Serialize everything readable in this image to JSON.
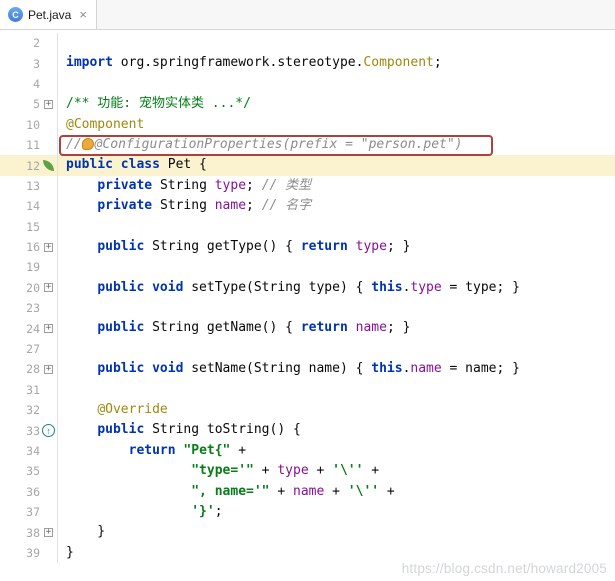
{
  "tab": {
    "title": "Pet.java",
    "close_glyph": "×",
    "icon_letter": "C"
  },
  "watermark": "https://blog.csdn.net/howard2005",
  "editor": {
    "colors": {
      "keyword": "#0033B3",
      "plain": "#080808",
      "annotation": "#9E880D",
      "comment": "#8C8C8C",
      "doc": "#067D17",
      "string": "#067D17",
      "field": "#871094",
      "line-number": "#A6A6A6",
      "current-line-bg": "#FBF2D0",
      "error-box": "#B1403B",
      "bean-icon": "#5FA243",
      "override-icon": "#0F8A80"
    },
    "lines": [
      {
        "num": 2,
        "segments": []
      },
      {
        "num": 3,
        "segments": [
          {
            "c": "keyword",
            "t": "import"
          },
          {
            "c": "plain",
            "t": " org.springframework.stereotype."
          },
          {
            "c": "annotation",
            "t": "Component"
          },
          {
            "c": "plain",
            "t": ";"
          }
        ]
      },
      {
        "num": 4,
        "segments": []
      },
      {
        "num": 5,
        "fold": "+",
        "segments": [
          {
            "c": "doc",
            "t": "/** 功能: 宠物实体类 ...*/"
          }
        ]
      },
      {
        "num": 10,
        "segments": [
          {
            "c": "annotation",
            "t": "@Component"
          }
        ]
      },
      {
        "num": 11,
        "boxed": true,
        "segments": [
          {
            "c": "comment",
            "t": "//"
          },
          {
            "ic": "bulb"
          },
          {
            "c": "comment",
            "t": "@ConfigurationProperties(prefix = \"person.pet\")"
          }
        ]
      },
      {
        "num": 12,
        "current": true,
        "gicon": "bean",
        "segments": [
          {
            "c": "keyword",
            "t": "public class "
          },
          {
            "c": "plain",
            "t": "Pet {"
          }
        ]
      },
      {
        "num": 13,
        "segments": [
          {
            "c": "plain",
            "t": "    "
          },
          {
            "c": "keyword",
            "t": "private "
          },
          {
            "c": "plain",
            "t": "String "
          },
          {
            "c": "field",
            "t": "type"
          },
          {
            "c": "plain",
            "t": "; "
          },
          {
            "c": "comment",
            "t": "// 类型"
          }
        ]
      },
      {
        "num": 14,
        "segments": [
          {
            "c": "plain",
            "t": "    "
          },
          {
            "c": "keyword",
            "t": "private "
          },
          {
            "c": "plain",
            "t": "String "
          },
          {
            "c": "field",
            "t": "name"
          },
          {
            "c": "plain",
            "t": "; "
          },
          {
            "c": "comment",
            "t": "// 名字"
          }
        ]
      },
      {
        "num": 15,
        "segments": []
      },
      {
        "num": 16,
        "fold": "+",
        "segments": [
          {
            "c": "plain",
            "t": "    "
          },
          {
            "c": "keyword",
            "t": "public "
          },
          {
            "c": "plain",
            "t": "String getType() { "
          },
          {
            "c": "keyword",
            "t": "return "
          },
          {
            "c": "field",
            "t": "type"
          },
          {
            "c": "plain",
            "t": "; }"
          }
        ]
      },
      {
        "num": 19,
        "segments": []
      },
      {
        "num": 20,
        "fold": "+",
        "segments": [
          {
            "c": "plain",
            "t": "    "
          },
          {
            "c": "keyword",
            "t": "public void "
          },
          {
            "c": "plain",
            "t": "setType(String type) { "
          },
          {
            "c": "keyword",
            "t": "this"
          },
          {
            "c": "plain",
            "t": "."
          },
          {
            "c": "field",
            "t": "type"
          },
          {
            "c": "plain",
            "t": " = type; }"
          }
        ]
      },
      {
        "num": 23,
        "segments": []
      },
      {
        "num": 24,
        "fold": "+",
        "segments": [
          {
            "c": "plain",
            "t": "    "
          },
          {
            "c": "keyword",
            "t": "public "
          },
          {
            "c": "plain",
            "t": "String getName() { "
          },
          {
            "c": "keyword",
            "t": "return "
          },
          {
            "c": "field",
            "t": "name"
          },
          {
            "c": "plain",
            "t": "; }"
          }
        ]
      },
      {
        "num": 27,
        "segments": []
      },
      {
        "num": 28,
        "fold": "+",
        "segments": [
          {
            "c": "plain",
            "t": "    "
          },
          {
            "c": "keyword",
            "t": "public void "
          },
          {
            "c": "plain",
            "t": "setName(String name) { "
          },
          {
            "c": "keyword",
            "t": "this"
          },
          {
            "c": "plain",
            "t": "."
          },
          {
            "c": "field",
            "t": "name"
          },
          {
            "c": "plain",
            "t": " = name; }"
          }
        ]
      },
      {
        "num": 31,
        "segments": []
      },
      {
        "num": 32,
        "segments": [
          {
            "c": "plain",
            "t": "    "
          },
          {
            "c": "annotation",
            "t": "@Override"
          }
        ]
      },
      {
        "num": 33,
        "gicon": "override",
        "segments": [
          {
            "c": "plain",
            "t": "    "
          },
          {
            "c": "keyword",
            "t": "public "
          },
          {
            "c": "plain",
            "t": "String toString() {"
          }
        ]
      },
      {
        "num": 34,
        "segments": [
          {
            "c": "plain",
            "t": "        "
          },
          {
            "c": "keyword",
            "t": "return "
          },
          {
            "c": "string",
            "t": "\"Pet{\""
          },
          {
            "c": "plain",
            "t": " +"
          }
        ]
      },
      {
        "num": 35,
        "segments": [
          {
            "c": "plain",
            "t": "                "
          },
          {
            "c": "string",
            "t": "\"type='\""
          },
          {
            "c": "plain",
            "t": " + "
          },
          {
            "c": "field",
            "t": "type"
          },
          {
            "c": "plain",
            "t": " + "
          },
          {
            "c": "string",
            "t": "'\\''"
          },
          {
            "c": "plain",
            "t": " +"
          }
        ]
      },
      {
        "num": 36,
        "segments": [
          {
            "c": "plain",
            "t": "                "
          },
          {
            "c": "string",
            "t": "\", name='\""
          },
          {
            "c": "plain",
            "t": " + "
          },
          {
            "c": "field",
            "t": "name"
          },
          {
            "c": "plain",
            "t": " + "
          },
          {
            "c": "string",
            "t": "'\\''"
          },
          {
            "c": "plain",
            "t": " +"
          }
        ]
      },
      {
        "num": 37,
        "segments": [
          {
            "c": "plain",
            "t": "                "
          },
          {
            "c": "string",
            "t": "'}'"
          },
          {
            "c": "plain",
            "t": ";"
          }
        ]
      },
      {
        "num": 38,
        "fold": "+",
        "segments": [
          {
            "c": "plain",
            "t": "    }"
          }
        ]
      },
      {
        "num": 39,
        "segments": [
          {
            "c": "plain",
            "t": "}"
          }
        ]
      }
    ]
  }
}
